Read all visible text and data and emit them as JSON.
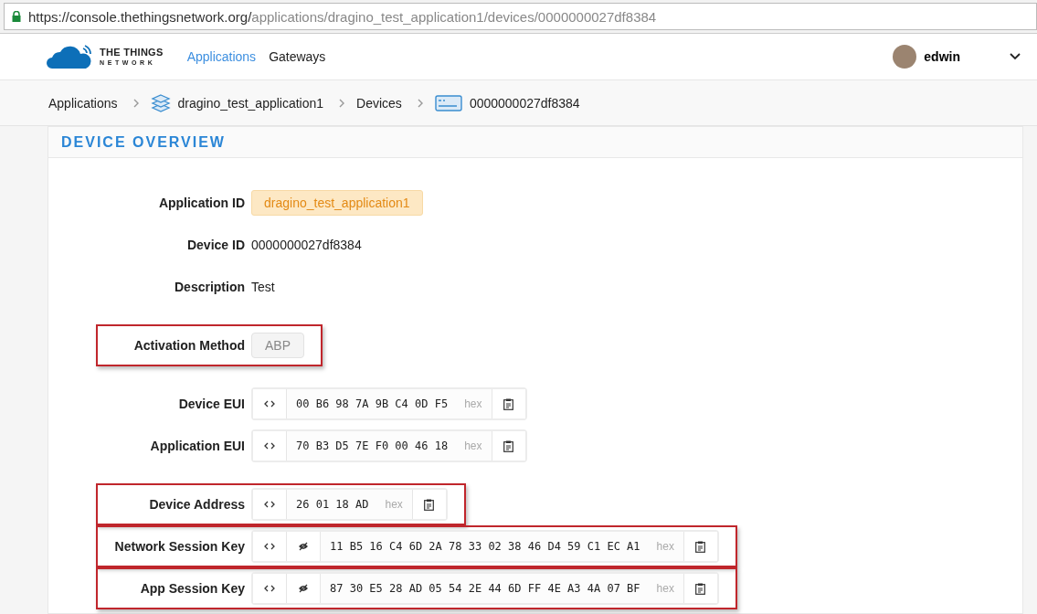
{
  "browser": {
    "url_host": "https://console.thethingsnetwork.org/",
    "url_path": "applications/dragino_test_application1/devices/0000000027df8384"
  },
  "header": {
    "logo_line1": "THE THINGS",
    "logo_line2": "NETWORK",
    "nav": [
      {
        "label": "Applications",
        "selected": true
      },
      {
        "label": "Gateways",
        "selected": false
      }
    ],
    "user": "edwin"
  },
  "breadcrumb": [
    {
      "label": "Applications",
      "kind": "plain"
    },
    {
      "label": "dragino_test_application1",
      "kind": "app"
    },
    {
      "label": "Devices",
      "kind": "plain"
    },
    {
      "label": "0000000027df8384",
      "kind": "device"
    }
  ],
  "section_title": "DEVICE OVERVIEW",
  "fields": [
    {
      "label": "Application ID",
      "kind": "badge",
      "value": "dragino_test_application1",
      "highlighted": false
    },
    {
      "label": "Device ID",
      "kind": "text",
      "value": "0000000027df8384",
      "highlighted": false
    },
    {
      "label": "Description",
      "kind": "text",
      "value": "Test",
      "highlighted": false
    },
    {
      "label": "Activation Method",
      "kind": "pill",
      "value": "ABP",
      "highlighted": true
    },
    {
      "label": "Device EUI",
      "kind": "hex",
      "value": "00 B6 98 7A 9B C4 0D F5",
      "unit": "hex",
      "secret": false,
      "highlighted": false
    },
    {
      "label": "Application EUI",
      "kind": "hex",
      "value": "70 B3 D5 7E F0 00 46 18",
      "unit": "hex",
      "secret": false,
      "highlighted": false
    },
    {
      "label": "Device Address",
      "kind": "hex",
      "value": "26 01 18 AD",
      "unit": "hex",
      "secret": false,
      "highlighted": true
    },
    {
      "label": "Network Session Key",
      "kind": "hex",
      "value": "11 B5 16 C4 6D 2A 78 33 02 38 46 D4 59 C1 EC A1",
      "unit": "hex",
      "secret": true,
      "highlighted": true
    },
    {
      "label": "App Session Key",
      "kind": "hex",
      "value": "87 30 E5 28 AD 05 54 2E 44 6D FF 4E A3 4A 07 BF",
      "unit": "hex",
      "secret": true,
      "highlighted": true
    }
  ]
}
